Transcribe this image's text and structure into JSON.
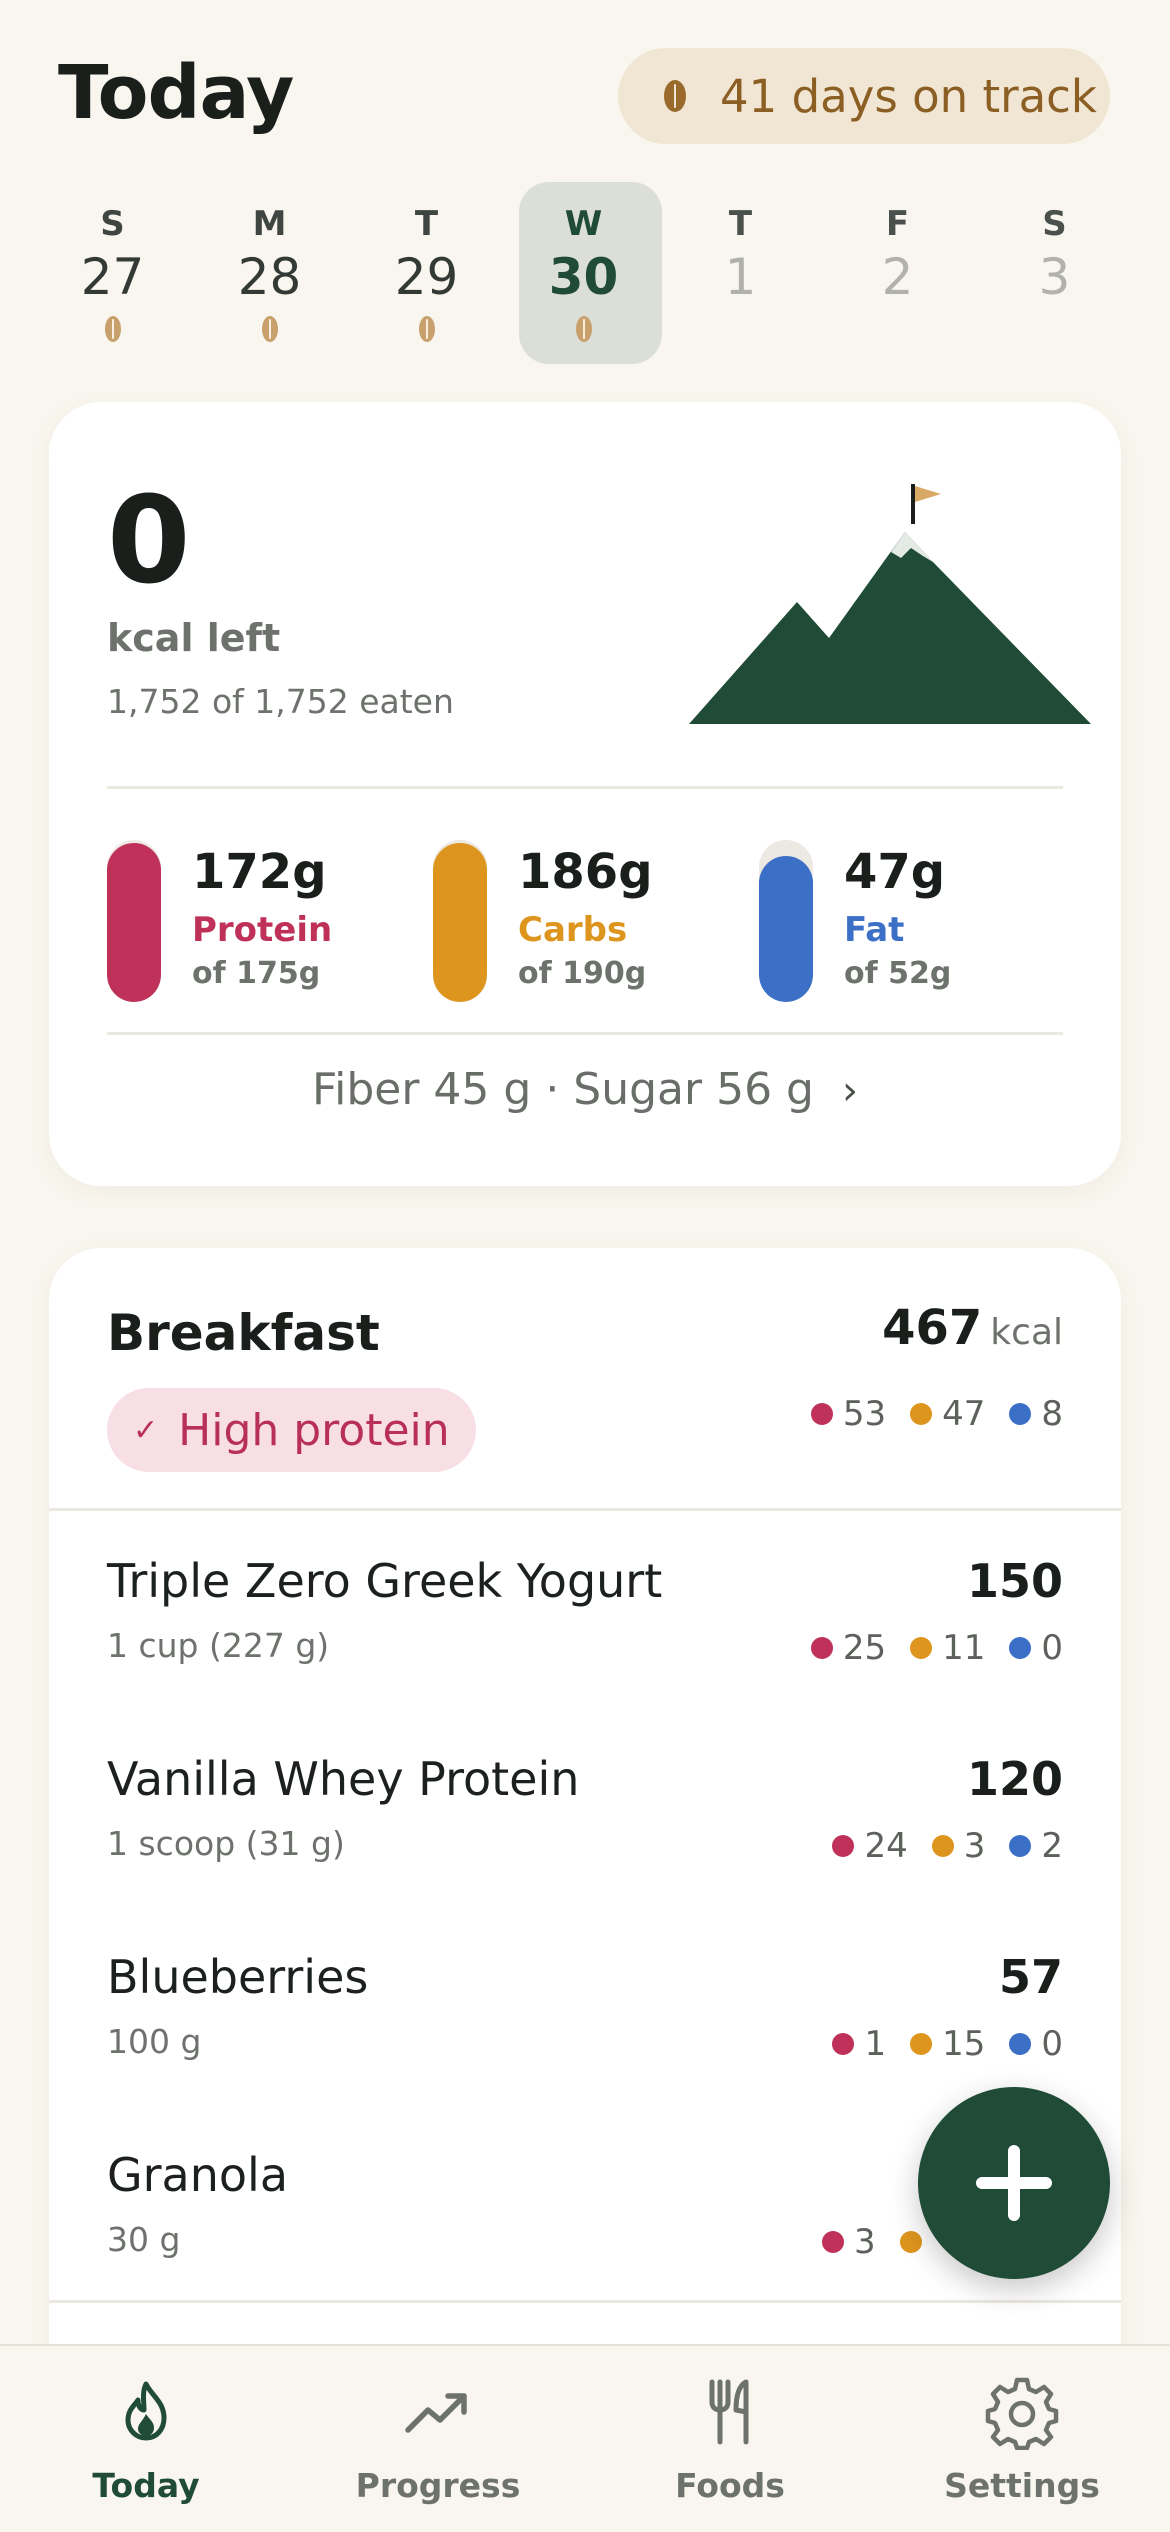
{
  "header": {
    "title": "Today",
    "streak_label": "41 days on track"
  },
  "week": [
    {
      "letter": "S",
      "num": "27",
      "logged": true,
      "selected": false,
      "future": false
    },
    {
      "letter": "M",
      "num": "28",
      "logged": true,
      "selected": false,
      "future": false
    },
    {
      "letter": "T",
      "num": "29",
      "logged": true,
      "selected": false,
      "future": false
    },
    {
      "letter": "W",
      "num": "30",
      "logged": true,
      "selected": true,
      "future": false
    },
    {
      "letter": "T",
      "num": "1",
      "logged": false,
      "selected": false,
      "future": true
    },
    {
      "letter": "F",
      "num": "2",
      "logged": false,
      "selected": false,
      "future": true
    },
    {
      "letter": "S",
      "num": "3",
      "logged": false,
      "selected": false,
      "future": true
    }
  ],
  "summary": {
    "kcal_left": "0",
    "kcal_left_label": "kcal left",
    "eaten_text": "1,752 of 1,752 eaten",
    "macros": [
      {
        "amount": "172g",
        "name": "Protein",
        "goal_text": "of 175g",
        "progress": 0.983,
        "color": "#bf3158"
      },
      {
        "amount": "186g",
        "name": "Carbs",
        "goal_text": "of 190g",
        "progress": 0.979,
        "color": "#de951d"
      },
      {
        "amount": "47g",
        "name": "Fat",
        "goal_text": "of 52g",
        "progress": 0.904,
        "color": "#3c6fc6"
      }
    ],
    "extras_text": "Fiber 45 g · Sugar 56 g"
  },
  "meal": {
    "title": "Breakfast",
    "kcal": "467",
    "kcal_unit": "kcal",
    "macros": [
      "53",
      "47",
      "8"
    ],
    "tag": "High protein",
    "items": [
      {
        "name": "Triple Zero Greek Yogurt",
        "serving": "1 cup (227 g)",
        "kcal": "150",
        "macros": [
          "25",
          "11",
          "0"
        ]
      },
      {
        "name": "Vanilla Whey Protein",
        "serving": "1 scoop (31 g)",
        "kcal": "120",
        "macros": [
          "24",
          "3",
          "2"
        ]
      },
      {
        "name": "Blueberries",
        "serving": "100 g",
        "kcal": "57",
        "macros": [
          "1",
          "15",
          "0"
        ]
      },
      {
        "name": "Granola",
        "serving": "30 g",
        "kcal": "",
        "macros": [
          "3",
          "",
          ""
        ]
      }
    ]
  },
  "colors": {
    "protein": "#bf3158",
    "carbs": "#de951d",
    "fat": "#3c6fc6",
    "brand": "#1f4b37"
  },
  "icons": {
    "streak": "coffee-bean-icon",
    "fab": "plus-icon"
  },
  "tabs": [
    {
      "label": "Today",
      "icon": "flame-icon",
      "active": true
    },
    {
      "label": "Progress",
      "icon": "trend-up-icon",
      "active": false
    },
    {
      "label": "Foods",
      "icon": "fork-knife-icon",
      "active": false
    },
    {
      "label": "Settings",
      "icon": "gear-icon",
      "active": false
    }
  ]
}
